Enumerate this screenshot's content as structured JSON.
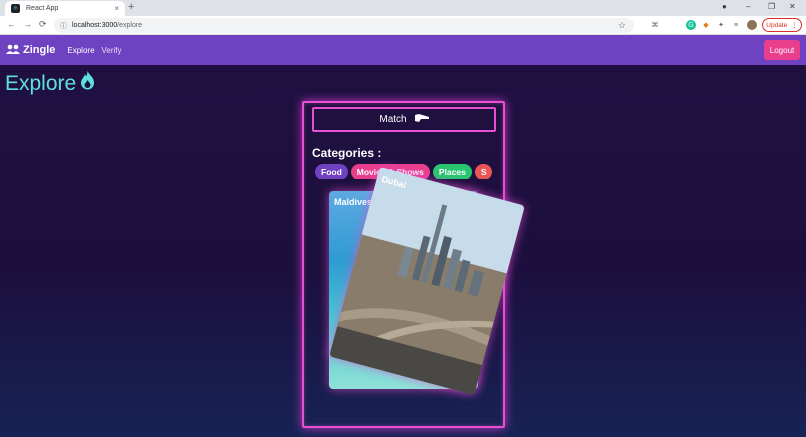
{
  "browser": {
    "tab_title": "React App",
    "tab_close": "×",
    "new_tab": "+",
    "url_host": "localhost:3000",
    "url_path": "/explore",
    "update_label": "Update",
    "back": "←",
    "forward": "→",
    "reload": "⟳",
    "info": "ⓘ",
    "star": "☆",
    "minimize": "–",
    "restore": "❐",
    "close": "✕"
  },
  "navbar": {
    "brand": "Zingle",
    "links": [
      "Explore",
      "Verify"
    ],
    "logout_label": "Logout",
    "color": "#6f42c1"
  },
  "page": {
    "title": "Explore",
    "match_label": "Match",
    "categories_title": "Categories :",
    "categories": [
      {
        "label": "Food",
        "color": "#6f42c1"
      },
      {
        "label": "Movies & Shows",
        "color": "#e83e8c"
      },
      {
        "label": "Places",
        "color": "#28c76f"
      },
      {
        "label": "S",
        "color": "#ea5455"
      }
    ],
    "cards": [
      {
        "label": "Maldives"
      },
      {
        "label": "Dubai"
      }
    ],
    "accent": "#e84fd1",
    "title_color": "#5ee0e0"
  }
}
